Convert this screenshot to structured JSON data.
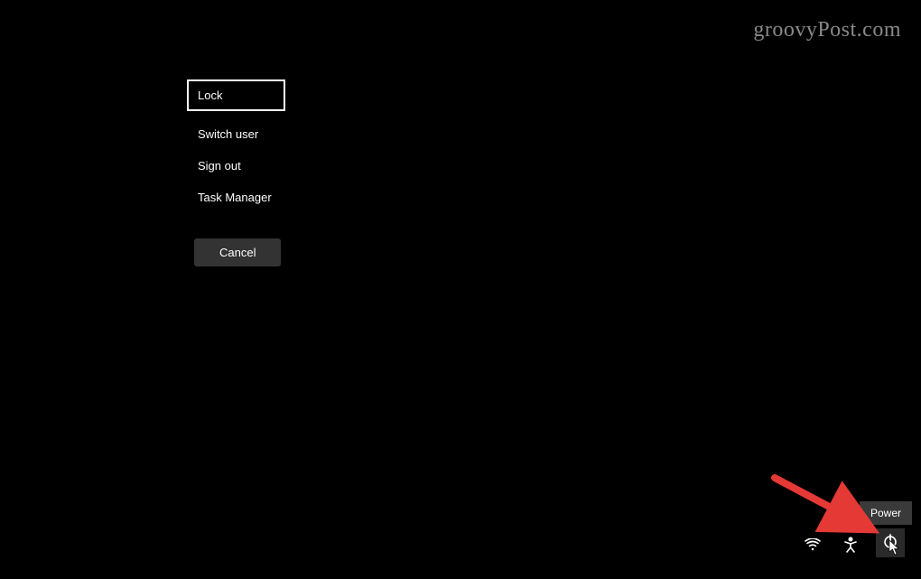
{
  "watermark": "groovyPost.com",
  "menu": {
    "items": [
      {
        "label": "Lock",
        "selected": true
      },
      {
        "label": "Switch user",
        "selected": false
      },
      {
        "label": "Sign out",
        "selected": false
      },
      {
        "label": "Task Manager",
        "selected": false
      }
    ],
    "cancel_label": "Cancel"
  },
  "tooltip": {
    "power_label": "Power"
  },
  "tray": {
    "wifi_icon": "wifi-icon",
    "accessibility_icon": "accessibility-icon",
    "power_icon": "power-icon"
  }
}
